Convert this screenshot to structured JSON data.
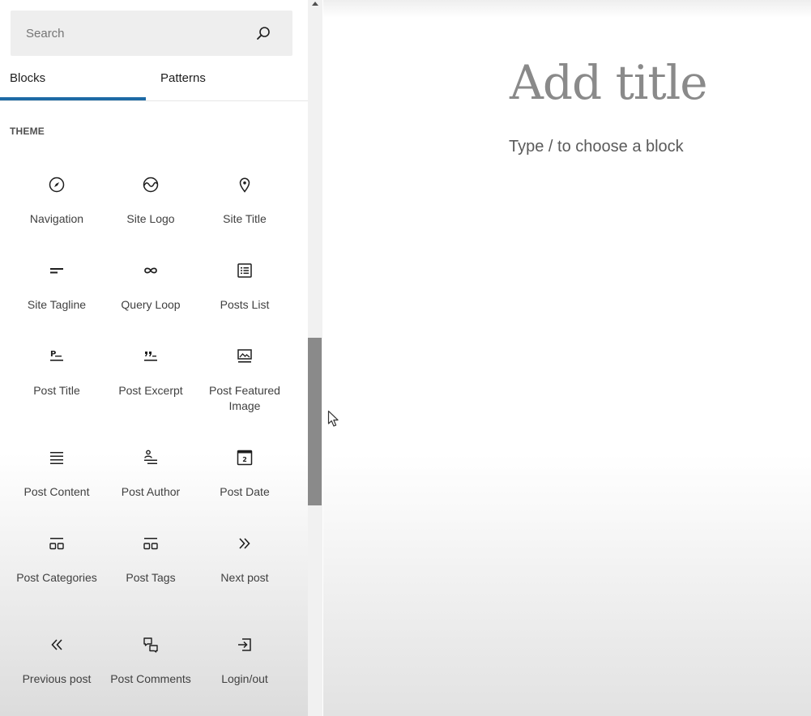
{
  "sidebar": {
    "search": {
      "placeholder": "Search",
      "value": ""
    },
    "tabs": [
      {
        "label": "Blocks",
        "active": true
      },
      {
        "label": "Patterns",
        "active": false
      }
    ],
    "section_label": "THEME",
    "blocks": [
      {
        "label": "Navigation",
        "icon": "compass-icon"
      },
      {
        "label": "Site Logo",
        "icon": "site-logo-icon"
      },
      {
        "label": "Site Title",
        "icon": "map-marker-icon"
      },
      {
        "label": "Site Tagline",
        "icon": "tagline-icon"
      },
      {
        "label": "Query Loop",
        "icon": "loop-icon"
      },
      {
        "label": "Posts List",
        "icon": "list-icon"
      },
      {
        "label": "Post Title",
        "icon": "post-title-icon"
      },
      {
        "label": "Post Excerpt",
        "icon": "quote-icon"
      },
      {
        "label": "Post Featured Image",
        "icon": "featured-image-icon"
      },
      {
        "label": "Post Content",
        "icon": "align-justify-icon"
      },
      {
        "label": "Post Author",
        "icon": "author-icon"
      },
      {
        "label": "Post Date",
        "icon": "calendar-icon"
      },
      {
        "label": "Post Categories",
        "icon": "categories-icon"
      },
      {
        "label": "Post Tags",
        "icon": "tags-icon"
      },
      {
        "label": "Next post",
        "icon": "double-chevron-right-icon"
      },
      {
        "label": "Previous post",
        "icon": "double-chevron-left-icon"
      },
      {
        "label": "Post Comments",
        "icon": "comments-icon"
      },
      {
        "label": "Login/out",
        "icon": "login-icon"
      }
    ],
    "calendar_day": "2",
    "post_title_icon_letter": "P"
  },
  "editor": {
    "title_placeholder": "Add title",
    "block_placeholder": "Type / to choose a block"
  },
  "colors": {
    "tab_indicator": "#1d6aa5",
    "scrollbar_thumb": "#8a8a8a"
  }
}
